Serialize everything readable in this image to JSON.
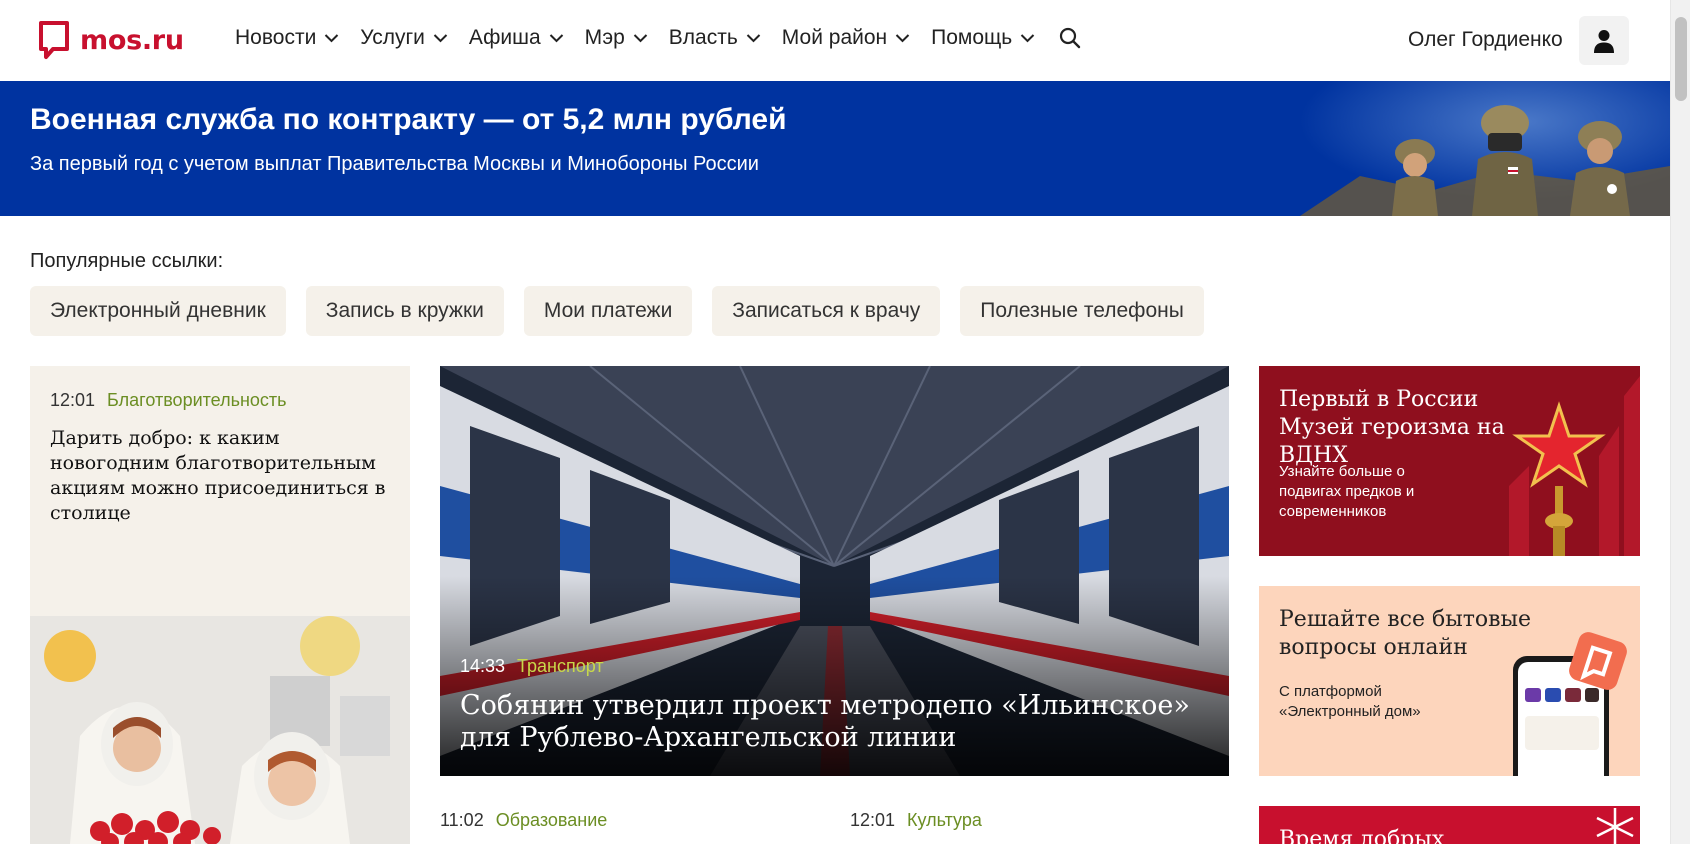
{
  "header": {
    "logo_text": "mos.ru",
    "nav": [
      {
        "label": "Новости"
      },
      {
        "label": "Услуги"
      },
      {
        "label": "Афиша"
      },
      {
        "label": "Мэр"
      },
      {
        "label": "Власть"
      },
      {
        "label": "Мой район"
      },
      {
        "label": "Помощь"
      }
    ],
    "user_name": "Олег Гордиенко"
  },
  "banner": {
    "title": "Военная служба по контракту — от 5,2 млн рублей",
    "subtitle": "За первый год с учетом выплат Правительства Москвы и Минобороны России"
  },
  "popular": {
    "label": "Популярные ссылки:",
    "links": [
      {
        "label": "Электронный дневник"
      },
      {
        "label": "Запись в кружки"
      },
      {
        "label": "Мои платежи"
      },
      {
        "label": "Записаться к врачу"
      },
      {
        "label": "Полезные телефоны"
      }
    ]
  },
  "news": {
    "left": {
      "time": "12:01",
      "category": "Благотворительность",
      "title": "Дарить добро: к каким новогодним благотворительным акциям можно присоединиться в столице"
    },
    "hero": {
      "time": "14:33",
      "category": "Транспорт",
      "title": "Собянин утвердил проект метродепо «Ильинское» для Рублево-Архангельской линии"
    },
    "bottom": [
      {
        "time": "11:02",
        "category": "Образование"
      },
      {
        "time": "12:01",
        "category": "Культура"
      }
    ]
  },
  "promos": [
    {
      "title": "Первый в России Музей героизма на ВДНХ",
      "subtitle": "Узнайте больше о подвигах предков и современников"
    },
    {
      "title": "Решайте все бытовые вопросы онлайн",
      "subtitle": "С платформой «Электронный дом»"
    },
    {
      "title": "Время добрых"
    }
  ],
  "colors": {
    "brand_red": "#c8102e",
    "banner_blue": "#0033a0",
    "chip_bg": "#f5f1ea",
    "category_green": "#6b8e23",
    "promo_museum": "#8f0f1e",
    "promo_home": "#fdd5bc"
  },
  "icons": [
    "logo-icon",
    "chevron-down-icon",
    "search-icon",
    "user-icon"
  ]
}
